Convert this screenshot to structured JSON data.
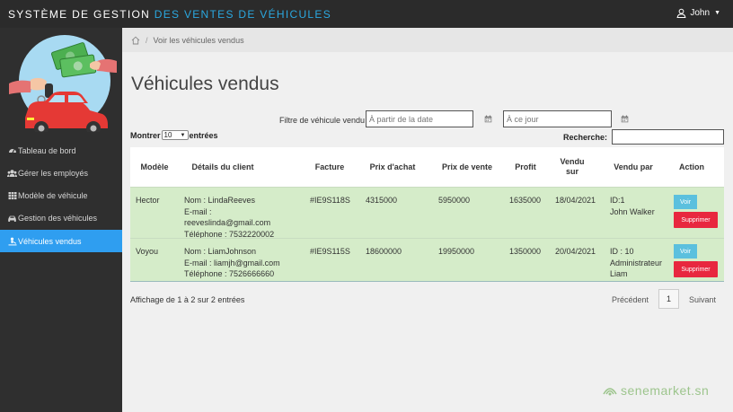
{
  "app": {
    "title_part1": "SYSTÈME DE GESTION",
    "title_part2": "DES VENTES DE VÉHICULES",
    "user_name": "John",
    "colors": {
      "accent": "#2ba8e0",
      "active_nav": "#2f9ef0",
      "row_highlight": "#d5ecc9",
      "danger": "#e8273f",
      "info": "#5bc0de"
    }
  },
  "sidebar": {
    "items": [
      {
        "label": "Tableau de bord",
        "icon": "dashboard-icon"
      },
      {
        "label": "Gérer les employés",
        "icon": "users-icon"
      },
      {
        "label": "Modèle de véhicule",
        "icon": "grid-icon"
      },
      {
        "label": "Gestion des véhicules",
        "icon": "car-icon"
      },
      {
        "label": "Véhicules vendus",
        "icon": "sold-icon",
        "active": true
      }
    ]
  },
  "breadcrumb": {
    "current": "Voir les véhicules vendus"
  },
  "page": {
    "title": "Véhicules vendus"
  },
  "filter": {
    "label": "Filtre de véhicule vendu",
    "from_placeholder": "À partir de la date",
    "to_placeholder": "À ce jour"
  },
  "table_controls": {
    "show_before": "Montrer",
    "show_value": "10",
    "show_after": "entrées",
    "search_label": "Recherche:"
  },
  "table": {
    "headers": [
      "Modèle",
      "Détails du client",
      "Facture",
      "Prix d'achat",
      "Prix de vente",
      "Profit",
      "Vendu sur",
      "Vendu par",
      "Action"
    ],
    "rows": [
      {
        "model": "Hector",
        "client_name": "Nom : LindaReeves",
        "client_email_label": "E-mail :",
        "client_email": "reeveslinda@gmail.com",
        "client_phone": "Téléphone : 7532220002",
        "invoice": "#IE9S118S",
        "purchase_price": "4315000",
        "sale_price": "5950000",
        "profit": "1635000",
        "sold_on": "18/04/2021",
        "sold_by_line1": "ID:1",
        "sold_by_line2": "John Walker",
        "sold_by_line3": "",
        "view_label": "Voir",
        "delete_label": "Supprimer"
      },
      {
        "model": "Voyou",
        "client_name": "Nom : LiamJohnson",
        "client_email_label": "E-mail : liamjh@gmail.com",
        "client_email": "",
        "client_phone": "Téléphone : 7526666660",
        "invoice": "#IE9S115S",
        "purchase_price": "18600000",
        "sale_price": "19950000",
        "profit": "1350000",
        "sold_on": "20/04/2021",
        "sold_by_line1": "ID : 10",
        "sold_by_line2": "Administrateur",
        "sold_by_line3": "Liam",
        "view_label": "Voir",
        "delete_label": "Supprimer"
      }
    ]
  },
  "footer": {
    "info": "Affichage de 1 à 2 sur 2 entrées",
    "prev": "Précédent",
    "page": "1",
    "next": "Suivant"
  },
  "watermark": {
    "text": "senemarket.sn"
  }
}
